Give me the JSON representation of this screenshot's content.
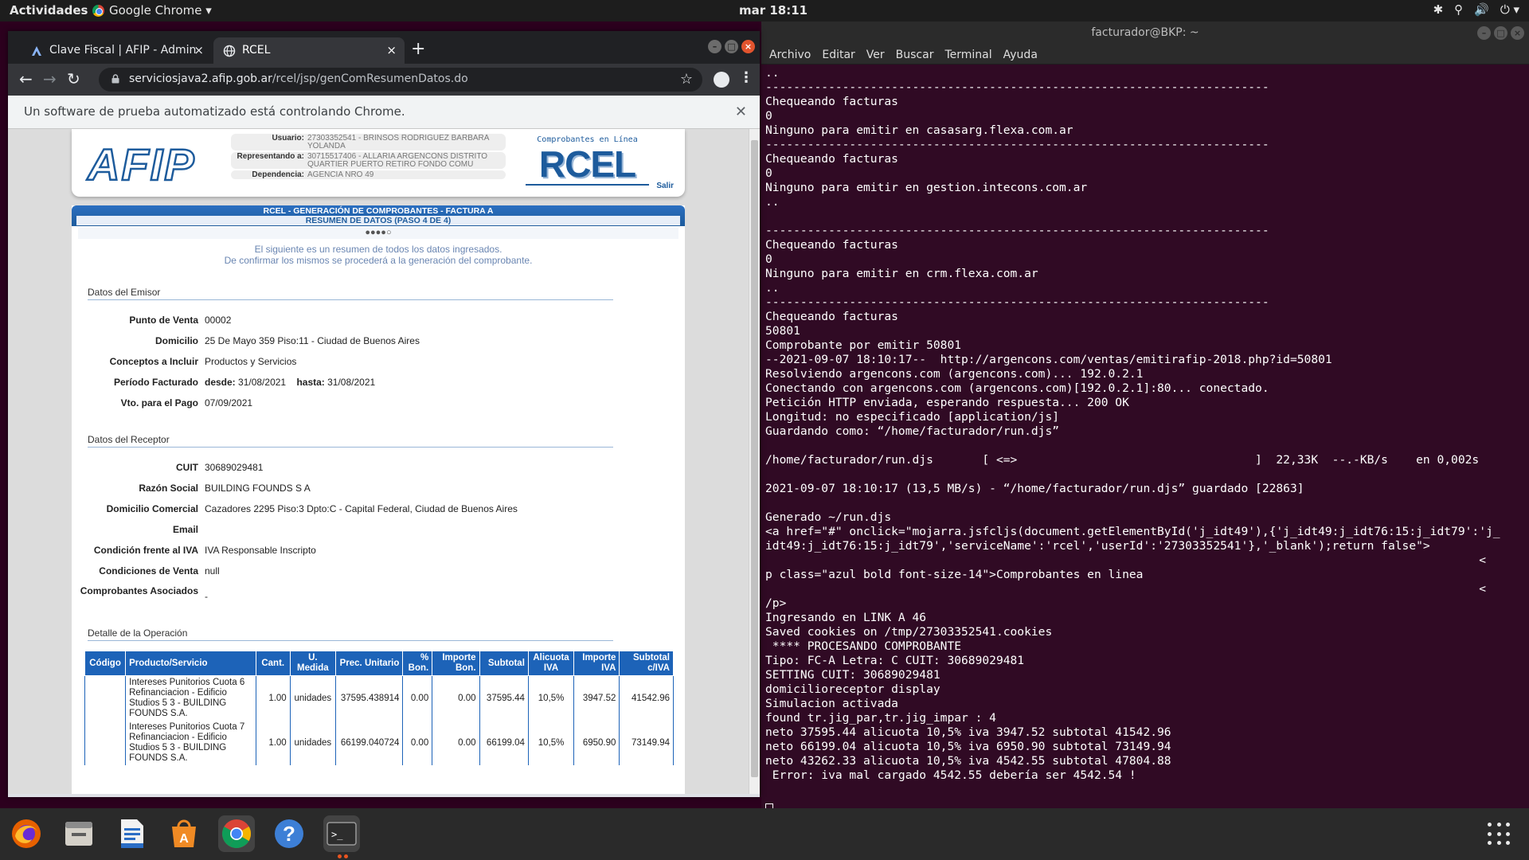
{
  "topbar": {
    "activities": "Actividades",
    "app_name": "Google Chrome ▾",
    "clock": "mar 18:11",
    "tray": [
      "✱",
      "⚲",
      "🔊",
      "⏻ ▾"
    ]
  },
  "chrome": {
    "tabs": [
      {
        "label": "Clave Fiscal | AFIP - Admin"
      },
      {
        "label": "RCEL"
      }
    ],
    "url_host": "serviciosjava2.afip.gob.ar",
    "url_path": "/rcel/jsp/genComResumenDatos.do",
    "infobar": "Un software de prueba automatizado está controlando Chrome.",
    "colors": {
      "accent": "#1d5b9c",
      "table_header": "#1d63b8"
    }
  },
  "afip": {
    "logo": "AFIP",
    "usuario_label": "Usuario:",
    "usuario": "27303352541 - BRINSOS RODRIGUEZ BARBARA YOLANDA",
    "representando_label": "Representando a:",
    "representando": "30715517406 - ALLARIA ARGENCONS DISTRITO QUARTIER PUERTO RETIRO FONDO COMU",
    "dependencia_label": "Dependencia:",
    "dependencia": "AGENCIA NRO 49",
    "rcel_sub": "Comprobantes en Línea",
    "rcel_logo": "RCEL",
    "salir": "Salir",
    "title_line1": "RCEL - GENERACIÓN DE COMPROBANTES - FACTURA A",
    "title_line2": "RESUMEN DE DATOS (PASO 4 DE 4)",
    "steps": "●●●●○",
    "intro1": "El siguiente es un resumen de todos los datos ingresados.",
    "intro2": "De confirmar los mismos se procederá a la generación del comprobante.",
    "emisor": {
      "title": "Datos del Emisor",
      "punto_venta_label": "Punto de Venta",
      "punto_venta": "00002",
      "domicilio_label": "Domicilio",
      "domicilio": "25 De Mayo 359 Piso:11 - Ciudad de Buenos Aires",
      "conceptos_label": "Conceptos a Incluir",
      "conceptos": "Productos y Servicios",
      "periodo_label": "Período Facturado",
      "desde_label": "desde:",
      "desde": "31/08/2021",
      "hasta_label": "hasta:",
      "hasta": "31/08/2021",
      "vto_label": "Vto. para el Pago",
      "vto": "07/09/2021"
    },
    "receptor": {
      "title": "Datos del Receptor",
      "cuit_label": "CUIT",
      "cuit": "30689029481",
      "razon_label": "Razón Social",
      "razon": "BUILDING FOUNDS S A",
      "domicilio_label": "Domicilio Comercial",
      "domicilio": "Cazadores 2295 Piso:3 Dpto:C - Capital Federal, Ciudad de Buenos Aires",
      "email_label": "Email",
      "email": "",
      "iva_label": "Condición frente al IVA",
      "iva": "IVA Responsable Inscripto",
      "venta_label": "Condiciones de Venta",
      "venta": "null",
      "asociados_label": "Comprobantes Asociados",
      "asociados": "-"
    },
    "detalle": {
      "title": "Detalle de la Operación",
      "headers": [
        "Código",
        "Producto/Servicio",
        "Cant.",
        "U. Medida",
        "Prec. Unitario",
        "% Bon.",
        "Importe Bon.",
        "Subtotal",
        "Alicuota IVA",
        "Importe IVA",
        "Subtotal c/IVA"
      ],
      "rows": [
        [
          "",
          "Intereses Punitorios Cuota 6 Refinanciacion - Edificio Studios 5 3 - BUILDING FOUNDS S.A.",
          "1.00",
          "unidades",
          "37595.438914",
          "0.00",
          "0.00",
          "37595.44",
          "10,5%",
          "3947.52",
          "41542.96"
        ],
        [
          "",
          "Intereses Punitorios Cuota 7 Refinanciacion - Edificio Studios 5 3 - BUILDING FOUNDS S.A.",
          "1.00",
          "unidades",
          "66199.040724",
          "0.00",
          "0.00",
          "66199.04",
          "10,5%",
          "6950.90",
          "73149.94"
        ]
      ]
    }
  },
  "terminal": {
    "title": "facturador@BKP: ~",
    "menu": [
      "Archivo",
      "Editar",
      "Ver",
      "Buscar",
      "Terminal",
      "Ayuda"
    ],
    "output": "..\n------------------------------------------------------------------------\nChequeando facturas\n0\nNinguno para emitir en casasarg.flexa.com.ar\n------------------------------------------------------------------------\nChequeando facturas\n0\nNinguno para emitir en gestion.intecons.com.ar\n..\n\n------------------------------------------------------------------------\nChequeando facturas\n0\nNinguno para emitir en crm.flexa.com.ar\n..\n------------------------------------------------------------------------\nChequeando facturas\n50801\nComprobante por emitir 50801\n--2021-09-07 18:10:17--  http://argencons.com/ventas/emitirafip-2018.php?id=50801\nResolviendo argencons.com (argencons.com)... 192.0.2.1\nConectando con argencons.com (argencons.com)[192.0.2.1]:80... conectado.\nPetición HTTP enviada, esperando respuesta... 200 OK\nLongitud: no especificado [application/js]\nGuardando como: “/home/facturador/run.djs”\n\n/home/facturador/run.djs       [ <=>                                  ]  22,33K  --.-KB/s    en 0,002s\n\n2021-09-07 18:10:17 (13,5 MB/s) - “/home/facturador/run.djs” guardado [22863]\n\nGenerado ~/run.djs\n<a href=\"#\" onclick=\"mojarra.jsfcljs(document.getElementById('j_idt49'),{'j_idt49:j_idt76:15:j_idt79':'j_\nidt49:j_idt76:15:j_idt79','serviceName':'rcel','userId':'27303352541'},'_blank');return false\">\n                                                                                                      <\np class=\"azul bold font-size-14\">Comprobantes en linea\n                                                                                                      <\n/p>\nIngresando en LINK A 46\nSaved cookies on /tmp/27303352541.cookies\n **** PROCESANDO COMPROBANTE\nTipo: FC-A Letra: C CUIT: 30689029481\nSETTING CUIT: 30689029481\ndomicilioreceptor display\nSimulacion activada\nfound tr.jig_par,tr.jig_impar : 4\nneto 37595.44 alicuota 10,5% iva 3947.52 subtotal 41542.96\nneto 66199.04 alicuota 10,5% iva 6950.90 subtotal 73149.94\nneto 43262.33 alicuota 10,5% iva 4542.55 subtotal 47804.88\n Error: iva mal cargado 4542.55 debería ser 4542.54 !"
  },
  "dock": {
    "apps": [
      "firefox-icon",
      "files-icon",
      "writer-icon",
      "software-icon",
      "chrome-icon",
      "help-icon",
      "terminal-icon"
    ],
    "help_glyph": "?",
    "terminal_glyph": ">_"
  }
}
